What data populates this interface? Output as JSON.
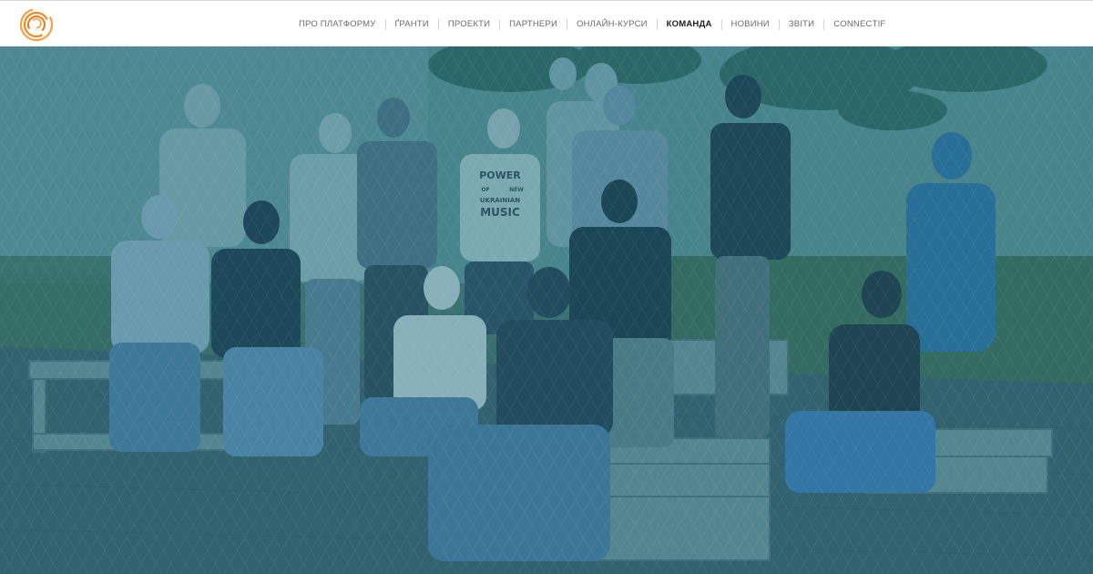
{
  "brand": {
    "logo_icon": "concentric-circles-logo-icon",
    "colors": {
      "logo_orange": "#f08a24",
      "overlay_teal": "#1e7f94",
      "nav_text": "#6b6b6b",
      "nav_active": "#1d1d1d"
    }
  },
  "nav": {
    "items": [
      {
        "label": "ПРО ПЛАТФОРМУ",
        "active": false
      },
      {
        "label": "ҐРАНТИ",
        "active": false
      },
      {
        "label": "ПРОЕКТИ",
        "active": false
      },
      {
        "label": "ПАРТНЕРИ",
        "active": false
      },
      {
        "label": "ОНЛАЙН-КУРСИ",
        "active": false
      },
      {
        "label": "КОМАНДА",
        "active": true
      },
      {
        "label": "НОВИНИ",
        "active": false
      },
      {
        "label": "ЗВІТИ",
        "active": false
      },
      {
        "label": "CONNECTIF",
        "active": false
      }
    ]
  },
  "hero": {
    "image_subject": "team-group-photo",
    "shirt_print": [
      "POWER",
      "OF",
      "NEW",
      "UKRAINIAN",
      "MUSIC"
    ]
  }
}
